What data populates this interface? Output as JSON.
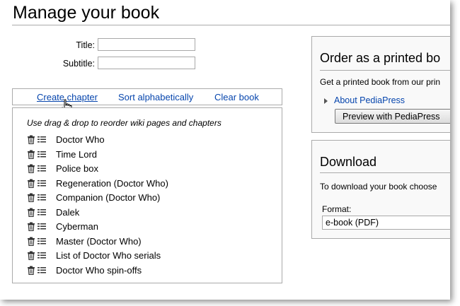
{
  "page": {
    "title": "Manage your book"
  },
  "form": {
    "title_label": "Title:",
    "title_value": "",
    "subtitle_label": "Subtitle:",
    "subtitle_value": ""
  },
  "actions": {
    "create_chapter": "Create chapter",
    "sort_alphabetically": "Sort alphabetically",
    "clear_book": "Clear book"
  },
  "items_box": {
    "hint": "Use drag & drop to reorder wiki pages and chapters",
    "items": [
      {
        "label": "Doctor Who"
      },
      {
        "label": "Time Lord"
      },
      {
        "label": "Police box"
      },
      {
        "label": "Regeneration (Doctor Who)"
      },
      {
        "label": "Companion (Doctor Who)"
      },
      {
        "label": "Dalek"
      },
      {
        "label": "Cyberman"
      },
      {
        "label": "Master (Doctor Who)"
      },
      {
        "label": "List of Doctor Who serials"
      },
      {
        "label": "Doctor Who spin-offs"
      }
    ]
  },
  "order_panel": {
    "heading": "Order as a printed bo",
    "text": "Get a printed book from our prin",
    "about_link": "About PediaPress",
    "preview_button": "Preview with PediaPress"
  },
  "download_panel": {
    "heading": "Download",
    "text": "To download your book choose",
    "format_label": "Format:",
    "format_value": "e-book (PDF)"
  },
  "icons": {
    "remove": "trash-icon",
    "rename": "list-icon",
    "cursor": "hand-pointer-icon"
  },
  "colors": {
    "link": "#0645ad",
    "border": "#aaaaaa"
  }
}
